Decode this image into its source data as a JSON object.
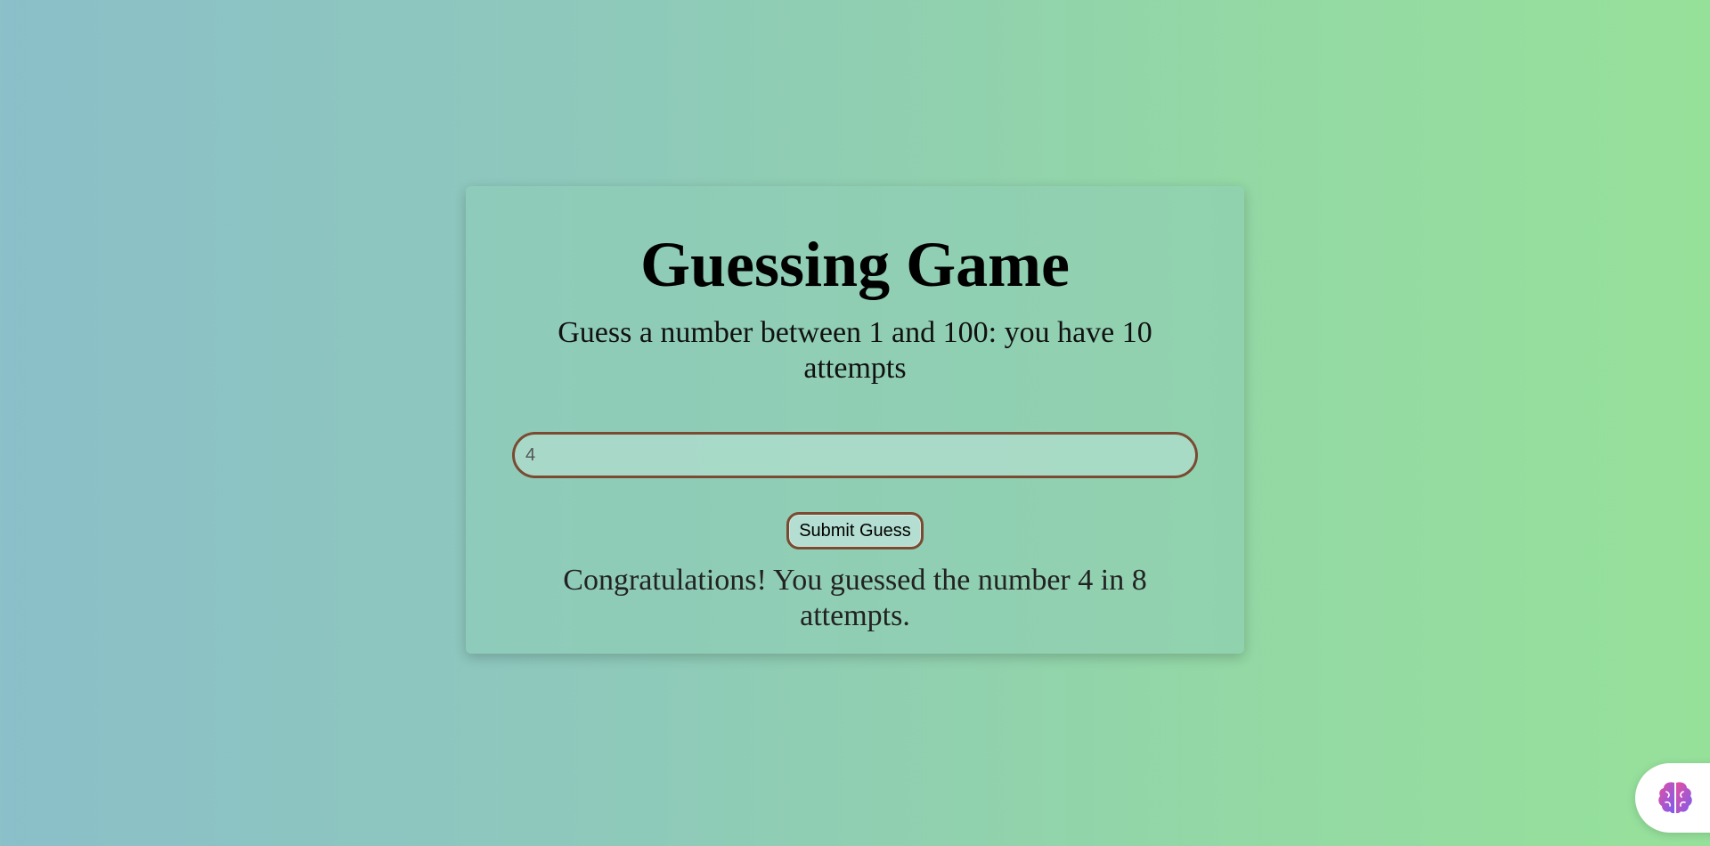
{
  "game": {
    "title": "Guessing Game",
    "instructions": "Guess a number between 1 and 100: you have 10 attempts",
    "input_value": "4",
    "submit_label": "Submit Guess",
    "result_message": "Congratulations! You guessed the number 4 in 8 attempts."
  },
  "floating": {
    "icon": "brain-icon"
  },
  "colors": {
    "gradient_start": "#8bbfc9",
    "gradient_end": "#96e19a",
    "input_border": "#7a4a32",
    "brain_pink": "#e64fa0",
    "brain_purple": "#7b5cf0"
  }
}
